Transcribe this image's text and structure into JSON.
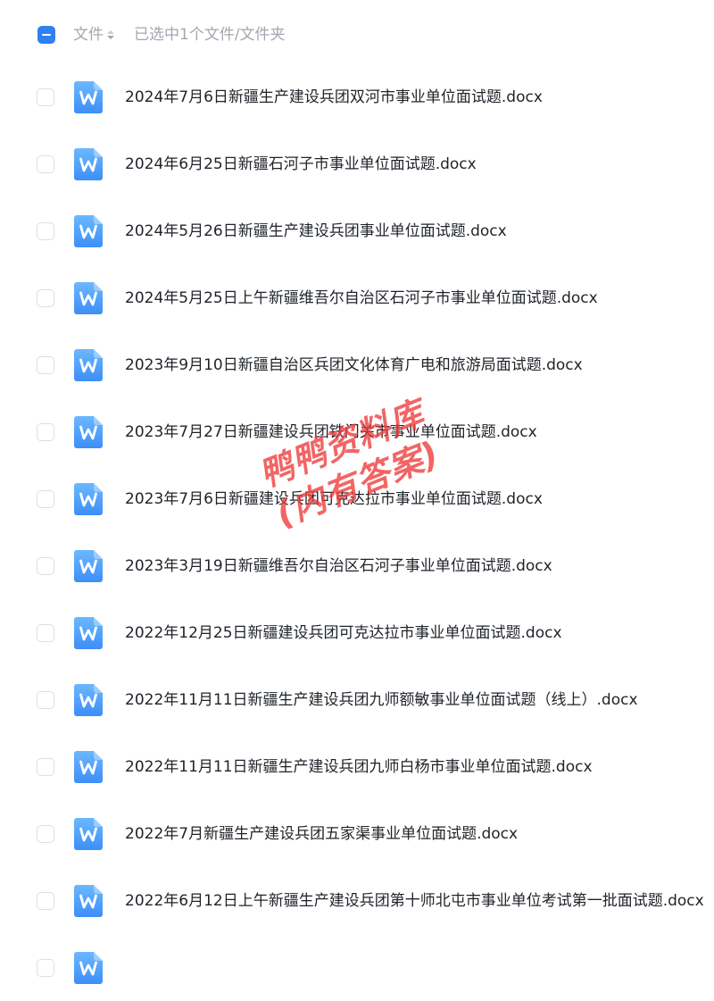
{
  "header": {
    "column_label": "文件",
    "selected_info": "已选中1个文件/文件夹"
  },
  "colors": {
    "accent": "#2f80f2",
    "file_icon_top": "#6cb8ff",
    "file_icon_bottom": "#3d8ef7",
    "watermark": "#ef3b3b"
  },
  "file_icon": "word-document-icon",
  "files": [
    {
      "name": "2024年7月6日新疆生产建设兵团双河市事业单位面试题.docx"
    },
    {
      "name": "2024年6月25日新疆石河子市事业单位面试题.docx"
    },
    {
      "name": "2024年5月26日新疆生产建设兵团事业单位面试题.docx"
    },
    {
      "name": "2024年5月25日上午新疆维吾尔自治区石河子市事业单位面试题.docx"
    },
    {
      "name": "2023年9月10日新疆自治区兵团文化体育广电和旅游局面试题.docx"
    },
    {
      "name": "2023年7月27日新疆建设兵团铁门关市事业单位面试题.docx"
    },
    {
      "name": "2023年7月6日新疆建设兵团可克达拉市事业单位面试题.docx"
    },
    {
      "name": "2023年3月19日新疆维吾尔自治区石河子事业单位面试题.docx"
    },
    {
      "name": "2022年12月25日新疆建设兵团可克达拉市事业单位面试题.docx"
    },
    {
      "name": "2022年11月11日新疆生产建设兵团九师额敏事业单位面试题（线上）.docx"
    },
    {
      "name": "2022年11月11日新疆生产建设兵团九师白杨市事业单位面试题.docx"
    },
    {
      "name": "2022年7月新疆生产建设兵团五家渠事业单位面试题.docx"
    },
    {
      "name": "2022年6月12日上午新疆生产建设兵团第十师北屯市事业单位考试第一批面试题.docx"
    },
    {
      "name": ""
    }
  ],
  "watermark": {
    "line1": "鸭鸭资料库",
    "line2": "(内有答案)"
  }
}
